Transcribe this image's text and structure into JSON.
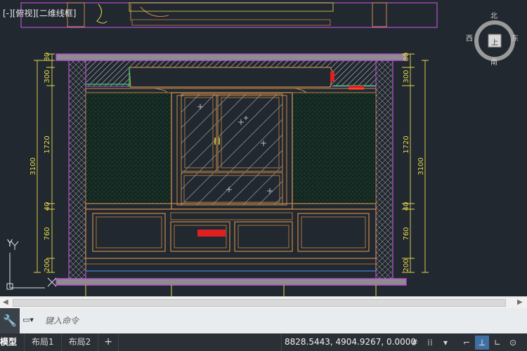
{
  "viewport": {
    "label": "[-][俯视][二维线框]",
    "compass": {
      "north": "北",
      "south": "南",
      "east": "东",
      "west": "西",
      "center": "上"
    },
    "ucs": {
      "y": "Y",
      "x": "X"
    },
    "dimensions": {
      "left": [
        "80",
        "300",
        "1720",
        "40",
        "760",
        "200"
      ],
      "left_total": "3100",
      "right": [
        "80",
        "300",
        "1720",
        "40",
        "760",
        "200"
      ],
      "right_total": "3100"
    },
    "colors": {
      "background": "#212830",
      "wall": "#b84fd4",
      "cabinet": "#c78a4a",
      "dimension": "#e6d84a",
      "highlight": "#e02020"
    }
  },
  "command": {
    "placeholder": "键入命令"
  },
  "status": {
    "tabs": [
      "模型",
      "布局1",
      "布局2",
      "+"
    ],
    "coords": "8828.5443, 4904.9267, 0.0000"
  },
  "icons": [
    "wrench-icon",
    "command-window-icon",
    "grid-icon",
    "snap-icon",
    "dropdown-icon",
    "infer-icon",
    "dynamic-ucs-icon",
    "ortho-icon"
  ]
}
